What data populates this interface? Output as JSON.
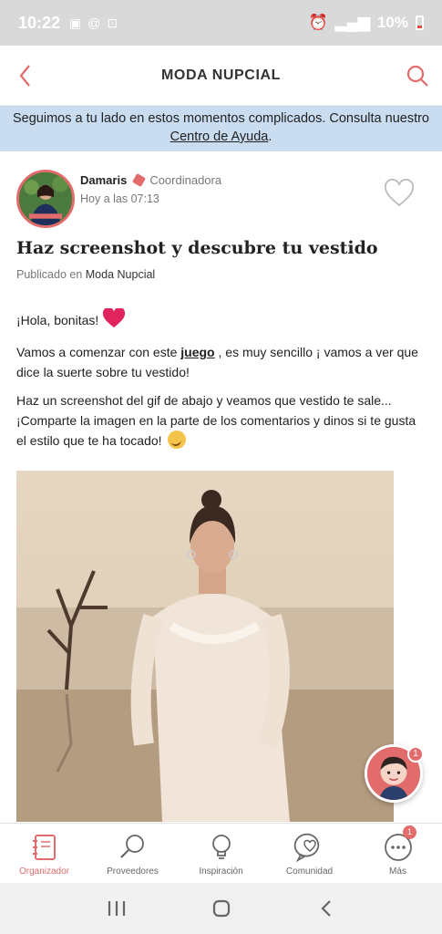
{
  "status_bar": {
    "time": "10:22",
    "battery": "10%",
    "battery_color": "#e74c3c"
  },
  "app_bar": {
    "title": "MODA NUPCIAL",
    "back_icon": "chevron-left-icon",
    "search_icon": "search-icon"
  },
  "banner": {
    "text_before": "Seguimos a tu lado en estos momentos complicados. Consulta nuestro ",
    "link": "Centro de Ayuda",
    "text_after": "."
  },
  "post": {
    "author_name": "Damaris",
    "author_role": "Coordinadora",
    "time": "Hoy a las 07:13",
    "title": "Haz screenshot y descubre tu vestido",
    "published_prefix": "Publicado en",
    "published_in": "Moda Nupcial",
    "p1": "¡Hola, bonitas! ",
    "p2_before": "Vamos a comenzar con este ",
    "p2_link": "juego",
    "p2_after": " , es muy sencillo ¡ vamos a ver que dice la suerte sobre tu vestido!",
    "p3": "Haz un screenshot del gif de abajo y veamos que vestido te sale... ¡Comparte la imagen en la parte de los comentarios y dinos si te gusta el estilo que te ha tocado! "
  },
  "chat_fab": {
    "badge": "1"
  },
  "bottom_nav": [
    {
      "label": "Organizador",
      "icon": "notebook-icon",
      "active": true
    },
    {
      "label": "Proveedores",
      "icon": "search-icon",
      "active": false
    },
    {
      "label": "Inspiración",
      "icon": "lightbulb-icon",
      "active": false
    },
    {
      "label": "Comunidad",
      "icon": "chat-heart-icon",
      "active": false
    },
    {
      "label": "Más",
      "icon": "more-icon",
      "active": false,
      "badge": "1"
    }
  ],
  "colors": {
    "accent": "#e26b6b",
    "banner_bg": "#c9dcf0"
  }
}
